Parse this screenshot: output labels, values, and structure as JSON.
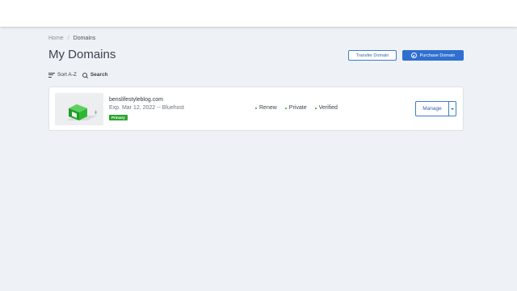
{
  "breadcrumb": {
    "home": "Home",
    "separator": "/",
    "current": "Domains"
  },
  "page": {
    "title": "My Domains"
  },
  "actions": {
    "transfer_label": "Transfer Domain",
    "purchase_label": "Purchase Domain"
  },
  "toolbar": {
    "sort_label": "Sort A-Z",
    "search_label": "Search"
  },
  "domains": [
    {
      "name": "benslifestyleblog.com",
      "expiry": "Exp. Mar 12, 2022 -- Bluehost",
      "badge": "Primary",
      "statuses": [
        "Renew",
        "Private",
        "Verified"
      ],
      "manage_label": "Manage"
    }
  ],
  "colors": {
    "accent": "#2f6fd0",
    "badge": "#2ba531",
    "background": "#eef1f5"
  },
  "icons": {
    "sort": "sort-lines-icon",
    "search": "search-icon",
    "purchase": "plus-circle-icon",
    "toggle": "chevron-down-icon"
  }
}
